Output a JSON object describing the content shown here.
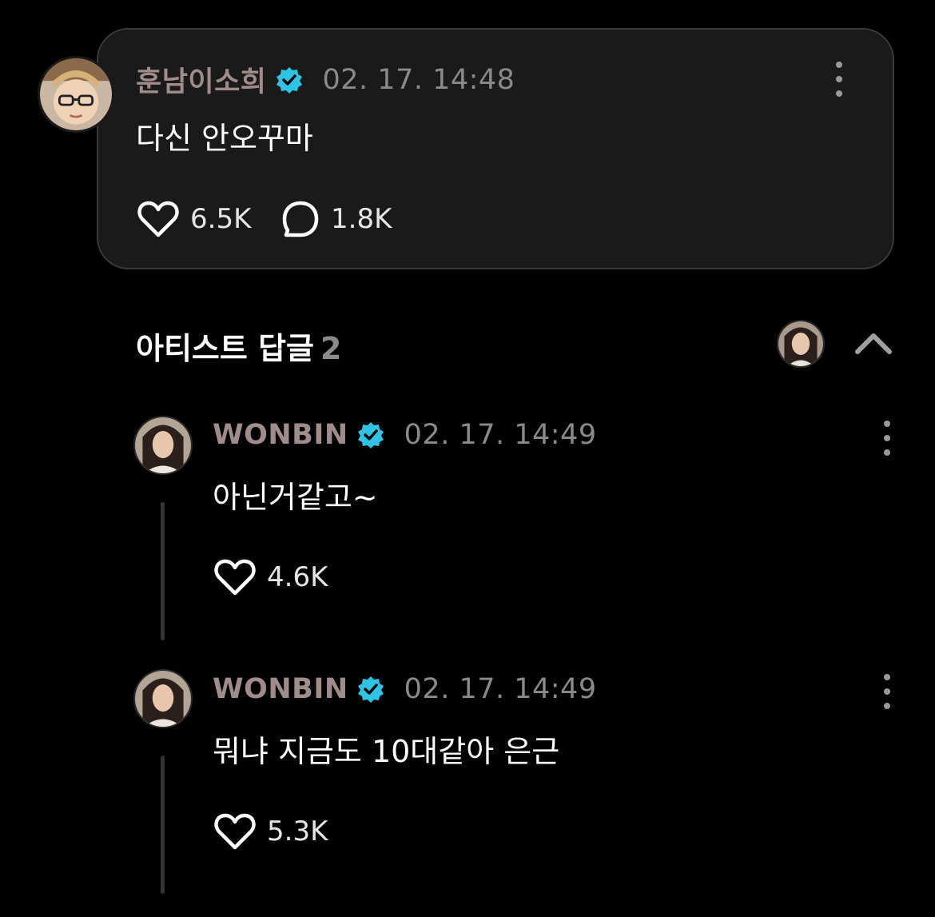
{
  "post": {
    "author": "훈남이소희",
    "timestamp": "02. 17. 14:48",
    "text": "다신 안오꾸마",
    "likes": "6.5K",
    "comments": "1.8K"
  },
  "artist_replies": {
    "title": "아티스트 답글",
    "count": "2"
  },
  "replies": [
    {
      "author": "WONBIN",
      "timestamp": "02. 17. 14:49",
      "text": "아닌거같고~",
      "likes": "4.6K"
    },
    {
      "author": "WONBIN",
      "timestamp": "02. 17. 14:49",
      "text": "뭐냐 지금도 10대같아 은근",
      "likes": "5.3K"
    }
  ],
  "icons": {
    "verified": "verified-badge-icon",
    "like": "heart-icon",
    "comment": "comment-bubble-icon",
    "more": "more-vertical-icon",
    "collapse": "chevron-up-icon"
  },
  "colors": {
    "background": "#000000",
    "card": "#1a1a1a",
    "card_border": "#3a3a3a",
    "author": "#a08c8a",
    "verified": "#2ec4e6",
    "muted": "#8a8a8a",
    "text": "#ffffff"
  }
}
